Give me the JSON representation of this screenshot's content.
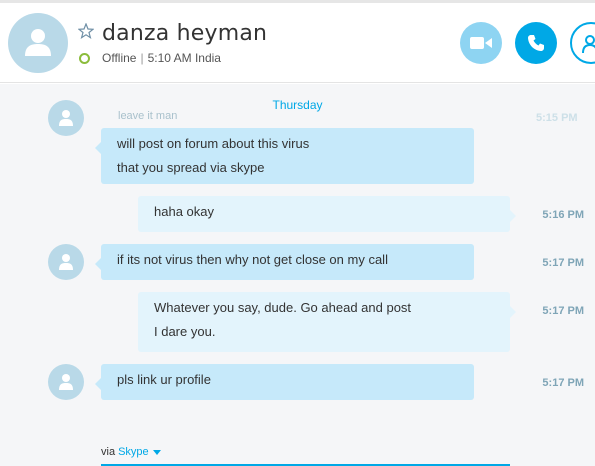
{
  "contact": {
    "name": "danza heyman",
    "status": "Offline",
    "local_time": "5:10 AM India"
  },
  "header_actions": {
    "video_icon": "video-camera-icon",
    "call_icon": "phone-icon",
    "add_icon": "add-person-icon"
  },
  "conversation": {
    "date_separator": "Thursday",
    "faded_preview": "leave it man",
    "messages": [
      {
        "direction": "incoming",
        "lines": [
          "will post on forum about this virus",
          "that you spread via skype"
        ],
        "time": ""
      },
      {
        "direction": "outgoing",
        "lines": [
          "haha okay"
        ],
        "time": "5:16 PM"
      },
      {
        "direction": "incoming",
        "lines": [
          "if its not virus then why not get close on my call"
        ],
        "time": "5:17 PM"
      },
      {
        "direction": "outgoing",
        "lines": [
          "Whatever you say, dude. Go ahead and post",
          "I dare you."
        ],
        "time": "5:17 PM"
      },
      {
        "direction": "incoming",
        "lines": [
          "pls link ur profile"
        ],
        "time": "5:17 PM"
      }
    ]
  },
  "compose": {
    "via_label": "via",
    "service": "Skype"
  },
  "colors": {
    "accent": "#00a8e6",
    "incoming_bubble": "#c6e9fa",
    "outgoing_bubble": "#e3f4fc",
    "presence_offline": "#8bbc3b"
  }
}
